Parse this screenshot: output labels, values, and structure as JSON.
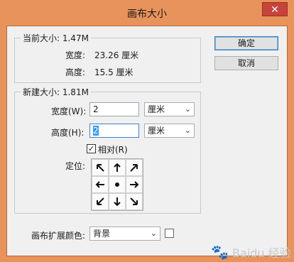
{
  "window": {
    "title": "画布大小",
    "close_glyph": "✕"
  },
  "current_size": {
    "group_label": "当前大小: 1.47M",
    "width_label": "宽度:",
    "width_value": "23.26 厘米",
    "height_label": "高度:",
    "height_value": "15.5 厘米"
  },
  "buttons": {
    "ok": "确定",
    "cancel": "取消"
  },
  "new_size": {
    "group_label": "新建大小: 1.81M",
    "width_label": "宽度(W):",
    "width_value": "2",
    "width_unit": "厘米",
    "height_label": "高度(H):",
    "height_value": "2",
    "height_unit": "厘米",
    "relative_label": "相对(R)",
    "relative_checked": true,
    "anchor_label": "定位:"
  },
  "canvas_extension": {
    "label": "画布扩展颜色:",
    "value": "背景"
  },
  "watermark": {
    "text": "Baidu 经验"
  }
}
